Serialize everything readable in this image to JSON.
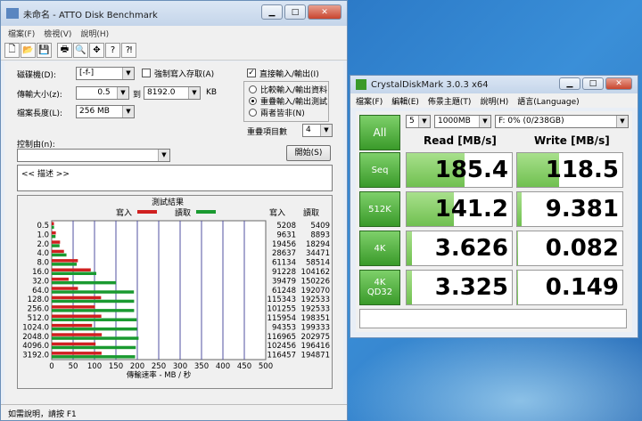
{
  "atto": {
    "title": "未命名 - ATTO Disk Benchmark",
    "menu": [
      "檔案(F)",
      "檢視(V)",
      "說明(H)"
    ],
    "drive_label": "磁碟機(D):",
    "drive_value": "[-f-]",
    "force_write": "強制寫入存取(A)",
    "direct_io": "直接輸入/輸出(I)",
    "transfer_label": "傳輸大小(z):",
    "transfer_from": "0.5",
    "transfer_to_label": "到",
    "transfer_to": "8192.0",
    "transfer_unit": "KB",
    "length_label": "檔案長度(L):",
    "length_value": "256 MB",
    "radio_compare": "比較輸入/輸出資料",
    "radio_overlap": "重疊輸入/輸出測試",
    "radio_neither": "兩者皆非(N)",
    "queue_label": "重疊項目數",
    "queue_value": "4",
    "control_label": "控制由(n):",
    "start_button": "開始(S)",
    "desc_text": "<<   描述   >>",
    "results_title": "測試結果",
    "legend_write": "寫入",
    "legend_read": "讀取",
    "col_write": "寫入",
    "col_read": "讀取",
    "xlabel": "傳輸速率 - MB / 秒",
    "x_ticks": [
      "0",
      "50",
      "100",
      "150",
      "200",
      "250",
      "300",
      "350",
      "400",
      "450",
      "500"
    ],
    "status": "如需說明，請按 F1",
    "colors": {
      "write": "#d02020",
      "read": "#1a9a30"
    }
  },
  "chart_data": {
    "type": "bar",
    "categories": [
      "0.5",
      "1.0",
      "2.0",
      "4.0",
      "8.0",
      "16.0",
      "32.0",
      "64.0",
      "128.0",
      "256.0",
      "512.0",
      "1024.0",
      "2048.0",
      "4096.0",
      "3192.0"
    ],
    "series": [
      {
        "name": "寫入",
        "values": [
          5208,
          9631,
          19456,
          28637,
          61134,
          91228,
          39479,
          61248,
          115343,
          101255,
          115954,
          94353,
          116965,
          102456,
          116457
        ]
      },
      {
        "name": "讀取",
        "values": [
          5409,
          8893,
          18294,
          34471,
          58514,
          104162,
          150226,
          192070,
          192533,
          192533,
          198351,
          199333,
          202975,
          196416,
          194871
        ]
      }
    ],
    "xlabel": "傳輸速率 - MB / 秒",
    "xlim": [
      0,
      500
    ]
  },
  "cdm": {
    "title": "CrystalDiskMark 3.0.3 x64",
    "menu": [
      "檔案(F)",
      "編輯(E)",
      "佈景主題(T)",
      "說明(H)",
      "語言(Language)"
    ],
    "all_button": "All",
    "runs": "5",
    "size": "1000MB",
    "drive": "F: 0% (0/238GB)",
    "read_header": "Read [MB/s]",
    "write_header": "Write [MB/s]",
    "rows": [
      {
        "label": "Seq",
        "read": "185.4",
        "write": "118.5",
        "read_frac": 0.55,
        "write_frac": 0.4
      },
      {
        "label": "512K",
        "read": "141.2",
        "write": "9.381",
        "read_frac": 0.45,
        "write_frac": 0.04
      },
      {
        "label": "4K",
        "read": "3.626",
        "write": "0.082",
        "read_frac": 0.05,
        "write_frac": 0.01
      },
      {
        "label": "4K\nQD32",
        "read": "3.325",
        "write": "0.149",
        "read_frac": 0.05,
        "write_frac": 0.01
      }
    ]
  }
}
